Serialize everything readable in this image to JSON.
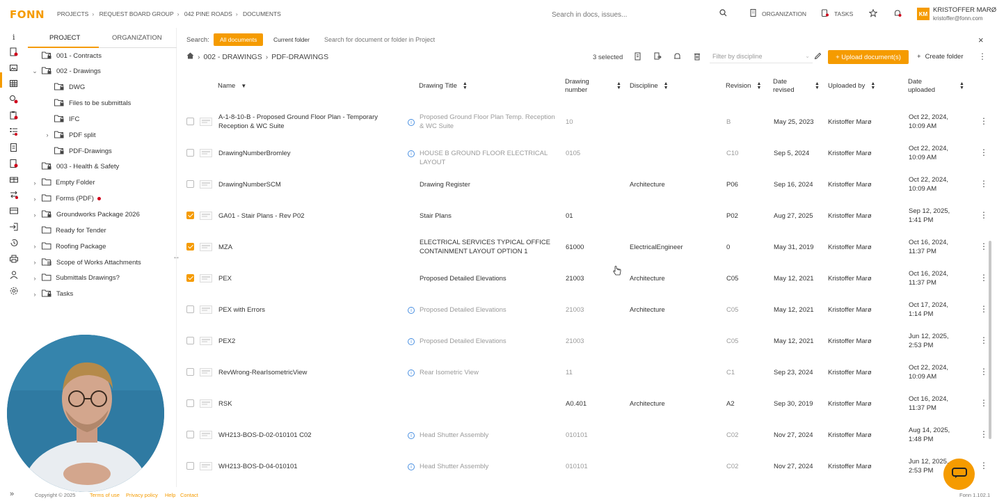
{
  "app": {
    "logo_text": "FONN"
  },
  "breadcrumbs": [
    "PROJECTS",
    "REQUEST BOARD GROUP",
    "042 PINE ROADS",
    "DOCUMENTS"
  ],
  "global_search": {
    "placeholder": "Search in docs, issues..."
  },
  "top_nav": {
    "organization_label": "ORGANIZATION",
    "tasks_label": "TASKS"
  },
  "user": {
    "initials": "KM",
    "name": "KRISTOFFER MARØ",
    "email": "kristoffer@fonn.com"
  },
  "tree": {
    "tabs": [
      "PROJECT",
      "ORGANIZATION"
    ],
    "active_tab": "PROJECT",
    "items": [
      {
        "label": "001 - Contracts",
        "level": 1,
        "chevron": "",
        "icon": "lock-folder-icon"
      },
      {
        "label": "002 - Drawings",
        "level": 1,
        "chevron": "down",
        "icon": "lock-folder-icon"
      },
      {
        "label": "DWG",
        "level": 2,
        "chevron": "",
        "icon": "lock-folder-icon"
      },
      {
        "label": "Files to be submittals",
        "level": 2,
        "chevron": "",
        "icon": "lock-folder-icon"
      },
      {
        "label": "IFC",
        "level": 2,
        "chevron": "",
        "icon": "lock-folder-icon"
      },
      {
        "label": "PDF split",
        "level": 2,
        "chevron": "right",
        "icon": "lock-folder-icon"
      },
      {
        "label": "PDF-Drawings",
        "level": 2,
        "chevron": "",
        "icon": "lock-folder-icon"
      },
      {
        "label": "003 - Health & Safety",
        "level": 1,
        "chevron": "",
        "icon": "lock-folder-icon"
      },
      {
        "label": "Empty Folder",
        "level": 1,
        "chevron": "right",
        "icon": "folder-icon"
      },
      {
        "label": "Forms (PDF)",
        "level": 1,
        "chevron": "right",
        "icon": "folder-icon",
        "dot": true
      },
      {
        "label": "Groundworks Package 2026",
        "level": 1,
        "chevron": "right",
        "icon": "lock-folder-icon"
      },
      {
        "label": "Ready for Tender",
        "level": 1,
        "chevron": "",
        "icon": "folder-icon"
      },
      {
        "label": "Roofing Package",
        "level": 1,
        "chevron": "right",
        "icon": "folder-icon"
      },
      {
        "label": "Scope of Works Attachments",
        "level": 1,
        "chevron": "right",
        "icon": "list-folder-icon"
      },
      {
        "label": "Submittals Drawings?",
        "level": 1,
        "chevron": "right",
        "icon": "folder-icon"
      },
      {
        "label": "Tasks",
        "level": 1,
        "chevron": "right",
        "icon": "lock-folder-icon"
      }
    ]
  },
  "search_bar": {
    "label": "Search:",
    "all_documents": "All documents",
    "current_folder": "Current folder",
    "placeholder": "Search for document or folder in Project"
  },
  "path": [
    "002 - DRAWINGS",
    "PDF-DRAWINGS"
  ],
  "toolbar": {
    "selected": "3 selected",
    "filter_placeholder": "Filter by discipline",
    "upload_label": "+ Upload document(s)",
    "create_folder_label": "Create folder"
  },
  "table": {
    "headers": {
      "name": "Name",
      "title": "Drawing Title",
      "number_line1": "Drawing",
      "number_line2": "number",
      "discipline": "Discipline",
      "revision": "Revision",
      "date_rev_line1": "Date",
      "date_rev_line2": "revised",
      "uploaded_by": "Uploaded by",
      "date_up_line1": "Date",
      "date_up_line2": "uploaded"
    },
    "rows": [
      {
        "name": "A-1-8-10-B - Proposed Ground Floor Plan - Temporary Reception & WC Suite",
        "title": "Proposed Ground Floor Plan Temp. Reception & WC Suite",
        "number": "10",
        "discipline": "",
        "revision": "B",
        "date_revised": "May 25, 2023",
        "uploaded_by": "Kristoffer Marø",
        "date_uploaded": "Oct 22, 2024, 10:09 AM",
        "checked": false,
        "muted": true,
        "info": true
      },
      {
        "name": "DrawingNumberBromley",
        "title": "HOUSE B GROUND FLOOR ELECTRICAL LAYOUT",
        "number": "0105",
        "discipline": "",
        "revision": "C10",
        "date_revised": "Sep 5, 2024",
        "uploaded_by": "Kristoffer Marø",
        "date_uploaded": "Oct 22, 2024, 10:09 AM",
        "checked": false,
        "muted": true,
        "info": true
      },
      {
        "name": "DrawingNumberSCM",
        "title": "Drawing Register",
        "number": "",
        "discipline": "Architecture",
        "revision": "P06",
        "date_revised": "Sep 16, 2024",
        "uploaded_by": "Kristoffer Marø",
        "date_uploaded": "Oct 22, 2024, 10:09 AM",
        "checked": false,
        "muted": false,
        "info": false
      },
      {
        "name": "GA01 - Stair Plans - Rev P02",
        "title": "Stair Plans",
        "number": "01",
        "discipline": "",
        "revision": "P02",
        "date_revised": "Aug 27, 2025",
        "uploaded_by": "Kristoffer Marø",
        "date_uploaded": "Sep 12, 2025, 1:41 PM",
        "checked": true,
        "muted": false,
        "info": false
      },
      {
        "name": "MZA",
        "title": "ELECTRICAL SERVICES TYPICAL OFFICE CONTAINMENT LAYOUT OPTION 1",
        "number": "61000",
        "discipline": "ElectricalEngineer",
        "revision": "0",
        "date_revised": "May 31, 2019",
        "uploaded_by": "Kristoffer Marø",
        "date_uploaded": "Oct 16, 2024, 11:37 PM",
        "checked": true,
        "muted": false,
        "info": false
      },
      {
        "name": "PEX",
        "title": "Proposed Detailed Elevations",
        "number": "21003",
        "discipline": "Architecture",
        "revision": "C05",
        "date_revised": "May 12, 2021",
        "uploaded_by": "Kristoffer Marø",
        "date_uploaded": "Oct 16, 2024, 11:37 PM",
        "checked": true,
        "muted": false,
        "info": false
      },
      {
        "name": "PEX with Errors",
        "title": "Proposed Detailed Elevations",
        "number": "21003",
        "discipline": "Architecture",
        "revision": "C05",
        "date_revised": "May 12, 2021",
        "uploaded_by": "Kristoffer Marø",
        "date_uploaded": "Oct 17, 2024, 1:14 PM",
        "checked": false,
        "muted": true,
        "info": true
      },
      {
        "name": "PEX2",
        "title": "Proposed Detailed Elevations",
        "number": "21003",
        "discipline": "",
        "revision": "C05",
        "date_revised": "May 12, 2021",
        "uploaded_by": "Kristoffer Marø",
        "date_uploaded": "Jun 12, 2025, 2:53 PM",
        "checked": false,
        "muted": true,
        "info": true
      },
      {
        "name": "RevWrong-RearIsometricView",
        "title": "Rear Isometric View",
        "number": "11",
        "discipline": "",
        "revision": "C1",
        "date_revised": "Sep 23, 2024",
        "uploaded_by": "Kristoffer Marø",
        "date_uploaded": "Oct 22, 2024, 10:09 AM",
        "checked": false,
        "muted": true,
        "info": true
      },
      {
        "name": "RSK",
        "title": "",
        "number": "A0.401",
        "discipline": "Architecture",
        "revision": "A2",
        "date_revised": "Sep 30, 2019",
        "uploaded_by": "Kristoffer Marø",
        "date_uploaded": "Oct 16, 2024, 11:37 PM",
        "checked": false,
        "muted": false,
        "info": false
      },
      {
        "name": "WH213-BOS-D-02-010101 C02",
        "title": "Head Shutter Assembly",
        "number": "010101",
        "discipline": "",
        "revision": "C02",
        "date_revised": "Nov 27, 2024",
        "uploaded_by": "Kristoffer Marø",
        "date_uploaded": "Aug 14, 2025, 1:48 PM",
        "checked": false,
        "muted": true,
        "info": true
      },
      {
        "name": "WH213-BOS-D-04-010101",
        "title": "Head Shutter Assembly",
        "number": "010101",
        "discipline": "",
        "revision": "C02",
        "date_revised": "Nov 27, 2024",
        "uploaded_by": "Kristoffer Marø",
        "date_uploaded": "Jun 12, 2025, 2:53 PM",
        "checked": false,
        "muted": true,
        "info": true
      }
    ]
  },
  "footer": {
    "copyright": "Copyright © 2025",
    "links": [
      "Terms of use",
      "Privacy policy",
      "Help",
      "Contact"
    ],
    "version": "Fonn 1.102.1"
  },
  "colors": {
    "accent": "#f59b00",
    "muted_text": "#9a9a9a",
    "info_blue": "#4a90e2",
    "notify_red": "#d0021b"
  }
}
